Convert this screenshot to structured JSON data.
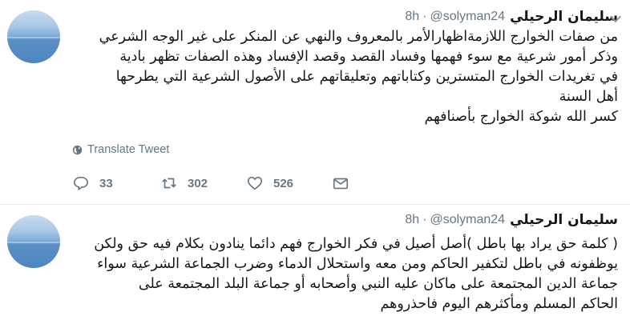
{
  "tweets": [
    {
      "name": "سليمان الرحيلي",
      "handle": "@solyman24",
      "dot": "·",
      "time": "8h",
      "lines": [
        "من صفات الخوارج اللازمةاظهارالأمر بالمعروف والنهي عن المنكر على غير الوجه الشرعي",
        "وذكر أمور شرعية مع سوء فهمها وفساد القصد وقصد الإفساد وهذه الصفات تظهر بادية",
        "في تغريدات الخوارج المتسترين وكتاباتهم وتعليقاتهم على الأصول الشرعية التي يطرحها",
        "أهل السنة",
        "كسر الله شوكة الخوارج بأصنافهم"
      ],
      "translate_label": "Translate Tweet",
      "reply_count": "33",
      "retweet_count": "302",
      "like_count": "526"
    },
    {
      "name": "سليمان الرحيلي",
      "handle": "@solyman24",
      "dot": "·",
      "time": "8h",
      "lines": [
        "( كلمة حق يراد بها باطل )أصل أصيل في فكر الخوارج فهم دائما ينادون بكلام فيه حق ولكن",
        "يوظفونه في باطل لتكفير الحاكم ومن معه واستحلال الدماء وضرب الجماعة الشرعية سواء",
        "جماعة الدين المجتمعة على ماكان عليه النبي وأصحابه أو جماعة البلد المجتمعة على",
        "الحاكم المسلم ومأكثرهم اليوم فاحذروهم"
      ]
    }
  ],
  "icons": {
    "avatar": "avatar-sea-horizon",
    "menu": "chevron-down-icon",
    "translate": "globe-icon",
    "reply": "reply-icon",
    "retweet": "retweet-icon",
    "like": "heart-icon",
    "dm": "envelope-icon"
  },
  "colors": {
    "text": "#14171a",
    "secondary": "#657786",
    "divider": "#e6ecf0"
  }
}
